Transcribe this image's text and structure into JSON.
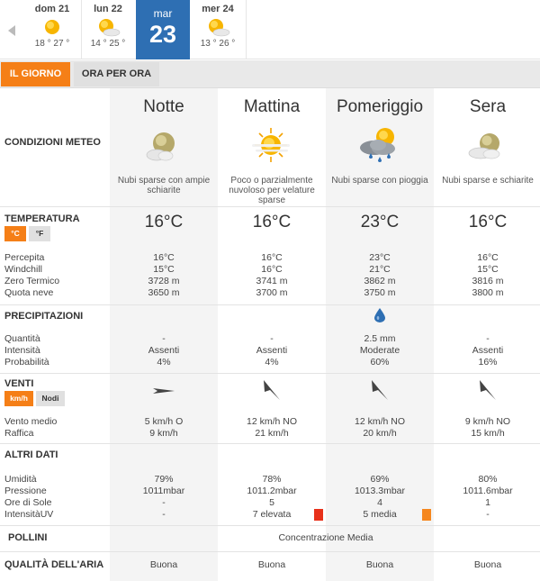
{
  "days": [
    {
      "name": "dom 21",
      "temps": "18 ° 27 °",
      "icon": "sun-icon"
    },
    {
      "name": "lun 22",
      "temps": "14 ° 25 °",
      "icon": "sun-cloud-icon"
    },
    {
      "name": "mar",
      "number": "23",
      "selected": true
    },
    {
      "name": "mer 24",
      "temps": "13 ° 26 °",
      "icon": "sun-cloud-icon"
    }
  ],
  "tabs": {
    "day": "IL GIORNO",
    "hourly": "ORA PER ORA"
  },
  "columns": [
    "Notte",
    "Mattina",
    "Pomeriggio",
    "Sera"
  ],
  "conditions": {
    "title": "CONDIZIONI METEO",
    "desc": [
      "Nubi sparse con ampie schiarite",
      "Poco o parzialmente nuvoloso per velature sparse",
      "Nubi sparse con pioggia",
      "Nubi sparse e schiarite"
    ]
  },
  "temperature": {
    "title": "TEMPERATURA",
    "unit_c": "°C",
    "unit_f": "°F",
    "values": [
      "16°C",
      "16°C",
      "23°C",
      "16°C"
    ],
    "labels": [
      "Percepita",
      "Windchill",
      "Zero Termico",
      "Quota neve"
    ],
    "rows": [
      [
        "16°C",
        "16°C",
        "23°C",
        "16°C"
      ],
      [
        "15°C",
        "16°C",
        "21°C",
        "15°C"
      ],
      [
        "3728 m",
        "3741 m",
        "3862 m",
        "3816 m"
      ],
      [
        "3650 m",
        "3700 m",
        "3750 m",
        "3800 m"
      ]
    ]
  },
  "precipitation": {
    "title": "PRECIPITAZIONI",
    "labels": [
      "Quantità",
      "Intensità",
      "Probabilità"
    ],
    "rows": [
      [
        "-",
        "-",
        "2.5 mm",
        "-"
      ],
      [
        "Assenti",
        "Assenti",
        "Moderate",
        "Assenti"
      ],
      [
        "4%",
        "4%",
        "60%",
        "16%"
      ]
    ]
  },
  "wind": {
    "title": "VENTI",
    "unit_kmh": "km/h",
    "unit_knots": "Nodi",
    "labels": [
      "Vento medio",
      "Raffica"
    ],
    "rows": [
      [
        "5 km/h  O",
        "12 km/h NO",
        "12 km/h NO",
        "9 km/h NO"
      ],
      [
        "9 km/h",
        "21 km/h",
        "20 km/h",
        "15 km/h"
      ]
    ]
  },
  "other": {
    "title": "ALTRI DATI",
    "labels": [
      "Umidità",
      "Pressione",
      "Ore di Sole",
      "IntensitàUV"
    ],
    "rows": [
      [
        "79%",
        "78%",
        "69%",
        "80%"
      ],
      [
        "1011mbar",
        "1011.2mbar",
        "1013.3mbar",
        "1011.6mbar"
      ],
      [
        "-",
        "5",
        "4",
        "1"
      ],
      [
        "-",
        "7 elevata",
        "5 media",
        "-"
      ]
    ],
    "uv_colors": [
      "",
      "#e8311a",
      "#f5871f",
      ""
    ]
  },
  "pollen": {
    "title": "POLLINI",
    "value": "Concentrazione Media"
  },
  "air": {
    "title": "QUALITÀ DELL'ARIA",
    "values": [
      "Buona",
      "Buona",
      "Buona",
      "Buona"
    ]
  },
  "colors": {
    "accent": "#f57f17",
    "selected_day": "#2e6fb3",
    "column_shade": "#f4f4f4"
  }
}
